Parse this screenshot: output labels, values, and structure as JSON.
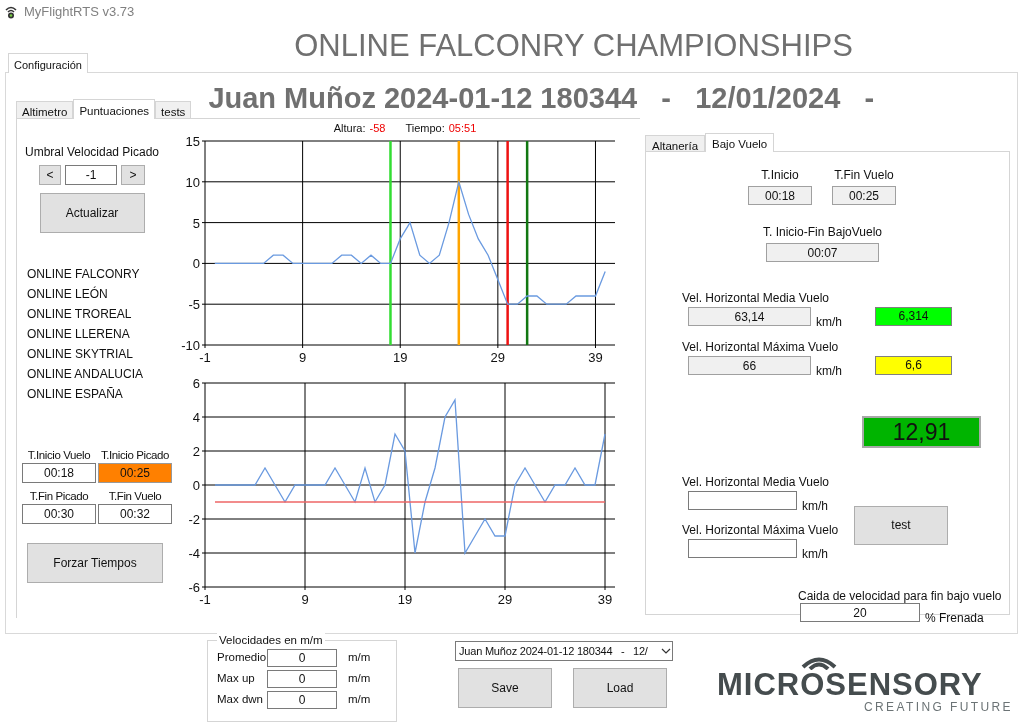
{
  "window": {
    "title": "MyFlightRTS v3.73"
  },
  "heading": "ONLINE FALCONRY CHAMPIONSHIPS",
  "outer_tabs": [
    {
      "label": "Configuración",
      "selected": true
    }
  ],
  "subtitle": "Juan Muñoz 2024-01-12 180344   -   12/01/2024   -",
  "inner_tabs": [
    {
      "label": "Altimetro",
      "selected": false
    },
    {
      "label": "Puntuaciones",
      "selected": true
    },
    {
      "label": "tests",
      "selected": false
    }
  ],
  "threshold": {
    "label": "Umbral Velocidad Picado",
    "decrement": "<",
    "value": "-1",
    "increment": ">",
    "button": "Actualizar"
  },
  "competitions": [
    "ONLINE FALCONRY",
    "ONLINE LEÓN",
    "ONLINE TROREAL",
    "ONLINE LLERENA",
    "ONLINE SKYTRIAL",
    "ONLINE ANDALUCIA",
    "ONLINE ESPAÑA"
  ],
  "times": [
    {
      "label": "T.Inicio Vuelo",
      "value": "00:18",
      "highlighted": false
    },
    {
      "label": "T.Inicio Picado",
      "value": "00:25",
      "highlighted": true
    },
    {
      "label": "T.Fin Picado",
      "value": "00:30",
      "highlighted": false
    },
    {
      "label": "T.Fin Vuelo",
      "value": "00:32",
      "highlighted": false
    }
  ],
  "force_button": "Forzar Tiempos",
  "altitude_chart": {
    "readouts": [
      {
        "label": "Altura:",
        "value": "-58"
      },
      {
        "label": "Tiempo:",
        "value": "05:51"
      }
    ],
    "chart_data": {
      "type": "line",
      "x": [
        0,
        1,
        2,
        3,
        4,
        5,
        6,
        7,
        8,
        9,
        10,
        11,
        12,
        13,
        14,
        15,
        16,
        17,
        18,
        19,
        20,
        21,
        22,
        23,
        24,
        25,
        26,
        27,
        28,
        29,
        30,
        31,
        32,
        33,
        34,
        35,
        36,
        37,
        38,
        39,
        40
      ],
      "series": [
        {
          "color": "#6a9ae0",
          "values": [
            0,
            0,
            0,
            0,
            0,
            0,
            1,
            1,
            0,
            0,
            0,
            0,
            0,
            1,
            1,
            0,
            1,
            0,
            0,
            3,
            5,
            1,
            0,
            1,
            5,
            10,
            6,
            3,
            1,
            -2,
            -5,
            -5,
            -4,
            -4,
            -5,
            -5,
            -5,
            -4,
            -4,
            -4,
            -1
          ]
        }
      ],
      "xlim": [
        -1,
        41
      ],
      "ylim": [
        -10,
        15
      ],
      "xticks": [
        -1,
        9,
        19,
        29,
        39
      ],
      "yticks": [
        -10,
        -5,
        0,
        5,
        10,
        15
      ],
      "grid": true,
      "ref_lines": [
        {
          "axis": "x",
          "value": 18,
          "color": "#33dd33"
        },
        {
          "axis": "x",
          "value": 25,
          "color": "#ffa500"
        },
        {
          "axis": "x",
          "value": 30,
          "color": "#ee1111"
        },
        {
          "axis": "x",
          "value": 32,
          "color": "#117711"
        }
      ]
    }
  },
  "speed_chart": {
    "chart_data": {
      "type": "line",
      "x": [
        0,
        1,
        2,
        3,
        4,
        5,
        6,
        7,
        8,
        9,
        10,
        11,
        12,
        13,
        14,
        15,
        16,
        17,
        18,
        19,
        20,
        21,
        22,
        23,
        24,
        25,
        26,
        27,
        28,
        29,
        30,
        31,
        32,
        33,
        34,
        35,
        36,
        37,
        38,
        39
      ],
      "series": [
        {
          "color": "#6a9ae0",
          "values": [
            0,
            0,
            0,
            0,
            0,
            1,
            0,
            -1,
            0,
            0,
            0,
            0,
            1,
            0,
            -1,
            1,
            -1,
            0,
            3,
            2,
            -4,
            -1,
            1,
            4,
            5,
            -4,
            -3,
            -2,
            -3,
            -3,
            0,
            1,
            0,
            -1,
            0,
            0,
            1,
            0,
            0,
            3
          ]
        },
        {
          "color": "#ee6666",
          "values": [
            -1,
            -1,
            -1,
            -1,
            -1,
            -1,
            -1,
            -1,
            -1,
            -1,
            -1,
            -1,
            -1,
            -1,
            -1,
            -1,
            -1,
            -1,
            -1,
            -1,
            -1,
            -1,
            -1,
            -1,
            -1,
            -1,
            -1,
            -1,
            -1,
            -1,
            -1,
            -1,
            -1,
            -1,
            -1,
            -1,
            -1,
            -1,
            -1,
            -1
          ]
        }
      ],
      "xlim": [
        -1,
        40
      ],
      "ylim": [
        -6,
        6
      ],
      "xticks": [
        -1,
        9,
        19,
        29,
        39
      ],
      "yticks": [
        -6,
        -4,
        -2,
        0,
        2,
        4,
        6
      ],
      "grid": true
    }
  },
  "result_tabs": [
    {
      "label": "Altanería",
      "selected": false
    },
    {
      "label": "Bajo Vuelo",
      "selected": true
    }
  ],
  "low_flight": {
    "start": {
      "label": "T.Inicio",
      "value": "00:18"
    },
    "end": {
      "label": "T.Fin Vuelo",
      "value": "00:25"
    },
    "duration": {
      "label": "T. Inicio-Fin BajoVuelo",
      "value": "00:07"
    },
    "speeds": [
      {
        "label": "Vel. Horizontal Media Vuelo",
        "value": "63,14",
        "unit": "km/h",
        "score": "6,314",
        "color": "#00ff00"
      },
      {
        "label": "Vel. Horizontal Máxima Vuelo",
        "value": "66",
        "unit": "km/h",
        "score": "6,6",
        "color": "#ffff00"
      }
    ],
    "total": {
      "value": "12,91",
      "color": "#00b400"
    },
    "test_inputs": [
      {
        "label": "Vel. Horizontal Media Vuelo",
        "unit": "km/h"
      },
      {
        "label": "Vel. Horizontal Máxima Vuelo",
        "unit": "km/h"
      }
    ],
    "test_button": "test",
    "drop": {
      "label": "Caida de velocidad para fin bajo vuelo",
      "value": "20",
      "unit": "% Frenada"
    }
  },
  "speeds_group": {
    "title": "Velocidades en m/m",
    "rows": [
      {
        "label": "Promedio",
        "value": "0",
        "unit": "m/m"
      },
      {
        "label": "Max up",
        "value": "0",
        "unit": "m/m"
      },
      {
        "label": "Max dwn",
        "value": "0",
        "unit": "m/m"
      }
    ]
  },
  "session_select": {
    "value": "Juan Muñoz 2024-01-12 180344   -   12/"
  },
  "buttons": [
    "Save",
    "Load"
  ],
  "logo": {
    "name": "MICROSENSORY",
    "tagline": "CREATING FUTURE"
  }
}
